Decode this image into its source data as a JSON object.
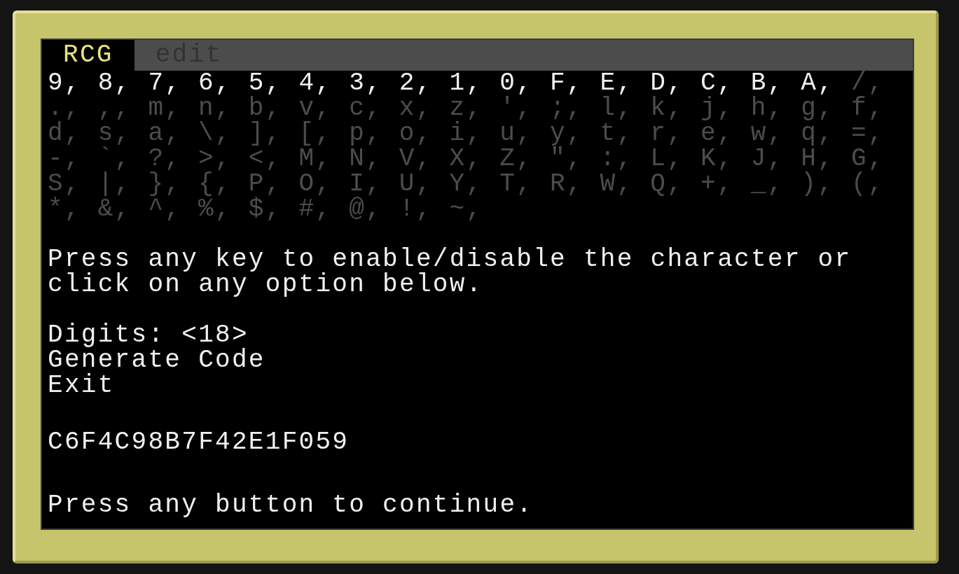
{
  "tabs": [
    {
      "label": "RCG",
      "selected": true
    },
    {
      "label": "edit",
      "selected": false
    }
  ],
  "character_rows": [
    [
      {
        "text": "9,",
        "enabled": true
      },
      {
        "text": "8,",
        "enabled": true
      },
      {
        "text": "7,",
        "enabled": true
      },
      {
        "text": "6,",
        "enabled": true
      },
      {
        "text": "5,",
        "enabled": true
      },
      {
        "text": "4,",
        "enabled": true
      },
      {
        "text": "3,",
        "enabled": true
      },
      {
        "text": "2,",
        "enabled": true
      },
      {
        "text": "1,",
        "enabled": true
      },
      {
        "text": "0,",
        "enabled": true
      },
      {
        "text": "F,",
        "enabled": true
      },
      {
        "text": "E,",
        "enabled": true
      },
      {
        "text": "D,",
        "enabled": true
      },
      {
        "text": "C,",
        "enabled": true
      },
      {
        "text": "B,",
        "enabled": true
      },
      {
        "text": "A,",
        "enabled": true
      },
      {
        "text": "/,",
        "enabled": false
      }
    ],
    [
      {
        "text": ".,",
        "enabled": false
      },
      {
        "text": ",,",
        "enabled": false
      },
      {
        "text": "m,",
        "enabled": false
      },
      {
        "text": "n,",
        "enabled": false
      },
      {
        "text": "b,",
        "enabled": false
      },
      {
        "text": "v,",
        "enabled": false
      },
      {
        "text": "c,",
        "enabled": false
      },
      {
        "text": "x,",
        "enabled": false
      },
      {
        "text": "z,",
        "enabled": false
      },
      {
        "text": "',",
        "enabled": false
      },
      {
        "text": ";,",
        "enabled": false
      },
      {
        "text": "l,",
        "enabled": false
      },
      {
        "text": "k,",
        "enabled": false
      },
      {
        "text": "j,",
        "enabled": false
      },
      {
        "text": "h,",
        "enabled": false
      },
      {
        "text": "g,",
        "enabled": false
      },
      {
        "text": "f,",
        "enabled": false
      }
    ],
    [
      {
        "text": "d,",
        "enabled": false
      },
      {
        "text": "s,",
        "enabled": false
      },
      {
        "text": "a,",
        "enabled": false
      },
      {
        "text": "\\,",
        "enabled": false
      },
      {
        "text": "],",
        "enabled": false
      },
      {
        "text": "[,",
        "enabled": false
      },
      {
        "text": "p,",
        "enabled": false
      },
      {
        "text": "o,",
        "enabled": false
      },
      {
        "text": "i,",
        "enabled": false
      },
      {
        "text": "u,",
        "enabled": false
      },
      {
        "text": "y,",
        "enabled": false
      },
      {
        "text": "t,",
        "enabled": false
      },
      {
        "text": "r,",
        "enabled": false
      },
      {
        "text": "e,",
        "enabled": false
      },
      {
        "text": "w,",
        "enabled": false
      },
      {
        "text": "q,",
        "enabled": false
      },
      {
        "text": "=,",
        "enabled": false
      }
    ],
    [
      {
        "text": "-,",
        "enabled": false
      },
      {
        "text": "`,",
        "enabled": false
      },
      {
        "text": "?,",
        "enabled": false
      },
      {
        "text": ">,",
        "enabled": false
      },
      {
        "text": "<,",
        "enabled": false
      },
      {
        "text": "M,",
        "enabled": false
      },
      {
        "text": "N,",
        "enabled": false
      },
      {
        "text": "V,",
        "enabled": false
      },
      {
        "text": "X,",
        "enabled": false
      },
      {
        "text": "Z,",
        "enabled": false
      },
      {
        "text": "\",",
        "enabled": false
      },
      {
        "text": ":,",
        "enabled": false
      },
      {
        "text": "L,",
        "enabled": false
      },
      {
        "text": "K,",
        "enabled": false
      },
      {
        "text": "J,",
        "enabled": false
      },
      {
        "text": "H,",
        "enabled": false
      },
      {
        "text": "G,",
        "enabled": false
      }
    ],
    [
      {
        "text": "S,",
        "enabled": false
      },
      {
        "text": "|,",
        "enabled": false
      },
      {
        "text": "},",
        "enabled": false
      },
      {
        "text": "{,",
        "enabled": false
      },
      {
        "text": "P,",
        "enabled": false
      },
      {
        "text": "O,",
        "enabled": false
      },
      {
        "text": "I,",
        "enabled": false
      },
      {
        "text": "U,",
        "enabled": false
      },
      {
        "text": "Y,",
        "enabled": false
      },
      {
        "text": "T,",
        "enabled": false
      },
      {
        "text": "R,",
        "enabled": false
      },
      {
        "text": "W,",
        "enabled": false
      },
      {
        "text": "Q,",
        "enabled": false
      },
      {
        "text": "+,",
        "enabled": false
      },
      {
        "text": "_,",
        "enabled": false
      },
      {
        "text": "),",
        "enabled": false
      },
      {
        "text": "(,",
        "enabled": false
      }
    ],
    [
      {
        "text": "*,",
        "enabled": false
      },
      {
        "text": "&,",
        "enabled": false
      },
      {
        "text": "^,",
        "enabled": false
      },
      {
        "text": "%,",
        "enabled": false
      },
      {
        "text": "$,",
        "enabled": false
      },
      {
        "text": "#,",
        "enabled": false
      },
      {
        "text": "@,",
        "enabled": false
      },
      {
        "text": "!,",
        "enabled": false
      },
      {
        "text": "~,",
        "enabled": false
      }
    ]
  ],
  "instructions": "Press any key to enable/disable the character or click on any option below.",
  "menu": [
    "Digits: <18>",
    "Generate Code",
    "Exit"
  ],
  "generated_code": "C6F4C98B7F42E1F059",
  "prompt": "Press any button to continue."
}
